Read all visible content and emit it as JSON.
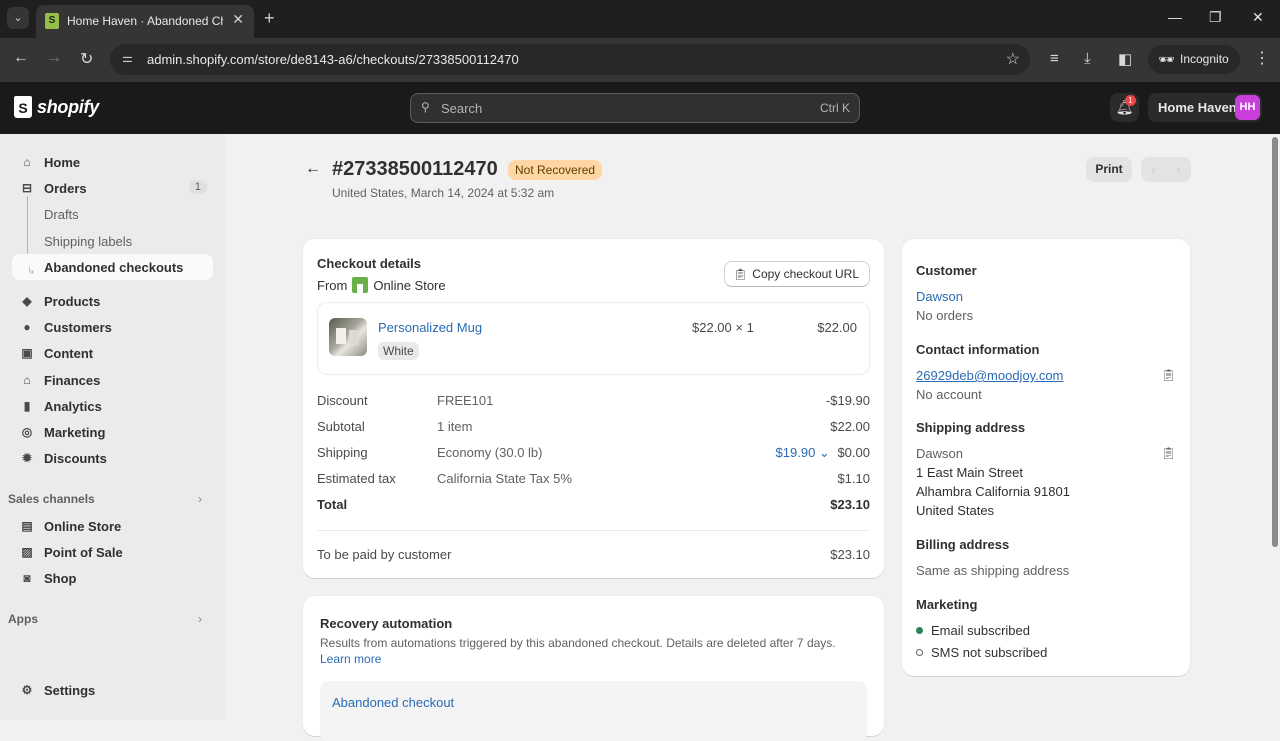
{
  "browser": {
    "tab_title": "Home Haven · Abandoned Che",
    "url": "admin.shopify.com/store/de8143-a6/checkouts/27338500112470",
    "incognito_label": "Incognito"
  },
  "topbar": {
    "logo_text": "shopify",
    "search_placeholder": "Search",
    "search_shortcut": "Ctrl K",
    "notification_count": "1",
    "store_name": "Home Haven",
    "store_initials": "HH"
  },
  "sidebar": {
    "items": [
      {
        "label": "Home",
        "icon": "home-icon"
      },
      {
        "label": "Orders",
        "icon": "inbox-icon",
        "count": "1"
      },
      {
        "label": "Drafts"
      },
      {
        "label": "Shipping labels"
      },
      {
        "label": "Abandoned checkouts",
        "active": true
      },
      {
        "label": "Products",
        "icon": "tag-icon"
      },
      {
        "label": "Customers",
        "icon": "person-icon"
      },
      {
        "label": "Content",
        "icon": "image-icon"
      },
      {
        "label": "Finances",
        "icon": "bank-icon"
      },
      {
        "label": "Analytics",
        "icon": "bar-chart-icon"
      },
      {
        "label": "Marketing",
        "icon": "target-icon"
      },
      {
        "label": "Discounts",
        "icon": "discount-icon"
      }
    ],
    "sales_channels_title": "Sales channels",
    "channels": [
      {
        "label": "Online Store",
        "icon": "store-icon"
      },
      {
        "label": "Point of Sale",
        "icon": "pos-icon"
      },
      {
        "label": "Shop",
        "icon": "shop-icon"
      }
    ],
    "apps_title": "Apps",
    "settings_label": "Settings"
  },
  "page": {
    "checkout_id": "#27338500112470",
    "status": "Not Recovered",
    "subtitle": "United States, March 14, 2024 at 5:32 am",
    "print_label": "Print"
  },
  "details": {
    "title": "Checkout details",
    "from_label": "From",
    "from_channel": "Online Store",
    "copy_label": "Copy checkout URL",
    "line_item": {
      "name": "Personalized Mug",
      "variant": "White",
      "unit_price": "$22.00 × 1",
      "total": "$22.00"
    },
    "summary": {
      "discount": {
        "label": "Discount",
        "desc": "FREE101",
        "amount": "-$19.90"
      },
      "subtotal": {
        "label": "Subtotal",
        "desc": "1 item",
        "amount": "$22.00"
      },
      "shipping": {
        "label": "Shipping",
        "desc": "Economy (30.0 lb)",
        "original": "$19.90",
        "amount": "$0.00"
      },
      "tax": {
        "label": "Estimated tax",
        "desc": "California State Tax 5%",
        "amount": "$1.10"
      },
      "total": {
        "label": "Total",
        "amount": "$23.10"
      },
      "paid": {
        "label": "To be paid by customer",
        "amount": "$23.10"
      }
    }
  },
  "recovery": {
    "title": "Recovery automation",
    "description": "Results from automations triggered by this abandoned checkout. Details are deleted after 7 days.",
    "learn_more": "Learn more",
    "item_link": "Abandoned checkout"
  },
  "customer": {
    "title": "Customer",
    "name": "Dawson",
    "orders": "No orders",
    "contact_title": "Contact information",
    "email": "26929deb@moodjoy.com",
    "account": "No account",
    "shipping_title": "Shipping address",
    "ship_name": "Dawson",
    "ship_line1": "1 East Main Street",
    "ship_line2": "Alhambra California 91801",
    "ship_country": "United States",
    "billing_title": "Billing address",
    "billing_value": "Same as shipping address",
    "marketing_title": "Marketing",
    "email_status": "Email subscribed",
    "sms_status": "SMS not subscribed"
  },
  "colors": {
    "status_badge_bg": "#ffd6a4",
    "link": "#2a6bb5",
    "avatar": "#c93fdc",
    "subscribed": "#29845a"
  }
}
